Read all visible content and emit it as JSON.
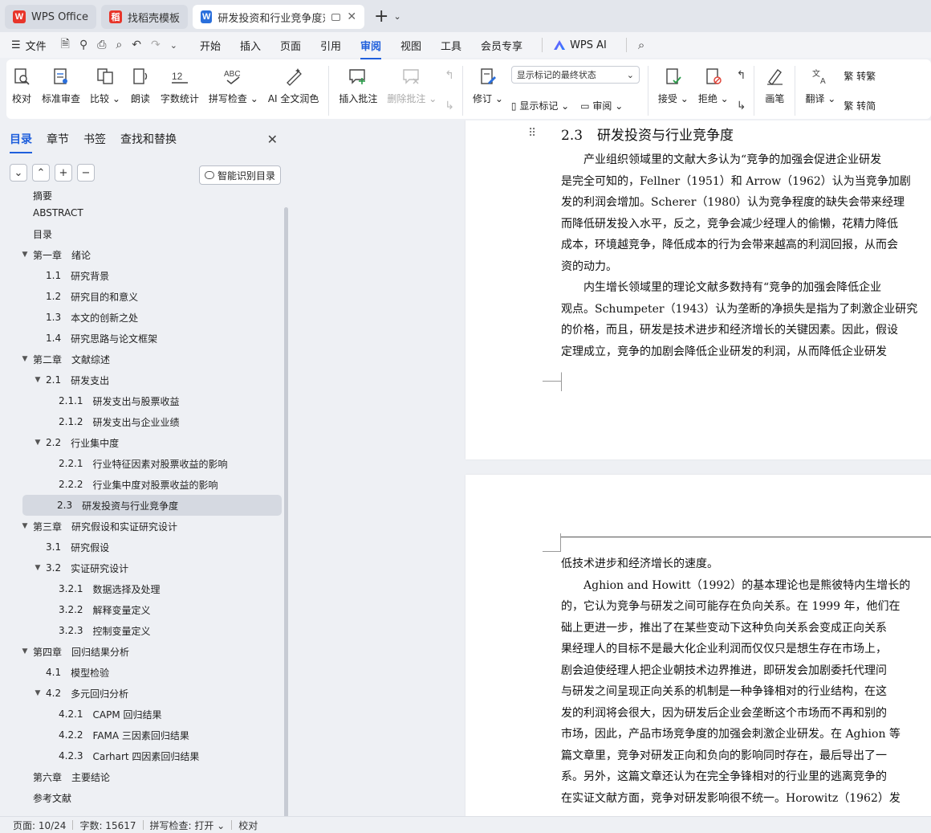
{
  "tabs": [
    {
      "label": "WPS Office",
      "logo": "W",
      "logo_color": "#e8352a",
      "icon": "wps-logo-icon"
    },
    {
      "label": "找稻壳模板",
      "logo": "稻",
      "logo_color": "#e8352a",
      "icon": "docer-logo-icon"
    },
    {
      "label": "研发投资和行业竞争度对股票",
      "logo": "W",
      "logo_color": "#2a6fdc",
      "icon": "writer-doc-icon",
      "active": true
    }
  ],
  "menubar": {
    "file": "文件",
    "items": [
      "开始",
      "插入",
      "页面",
      "引用",
      "审阅",
      "视图",
      "工具",
      "会员专享"
    ],
    "active": "审阅",
    "wps_ai": "WPS AI"
  },
  "ribbon": {
    "proofread": "校对",
    "std_review": "标准审查",
    "compare": "比较",
    "read_aloud": "朗读",
    "word_count": "字数统计",
    "spell_check": "拼写检查",
    "ai_polish": "AI 全文润色",
    "insert_comment": "插入批注",
    "delete_comment": "删除批注",
    "track_changes": "修订",
    "markup_dropdown": "显示标记的最终状态",
    "show_markup": "显示标记",
    "review": "审阅",
    "accept": "接受",
    "reject": "拒绝",
    "pen": "画笔",
    "translate": "翻译",
    "to_traditional": "转繁",
    "to_simplified": "转简"
  },
  "nav": {
    "tabs": [
      "目录",
      "章节",
      "书签",
      "查找和替换"
    ],
    "active_tab": "目录",
    "smart_btn": "智能识别目录",
    "toc": [
      {
        "num": "",
        "title": "摘要",
        "level": 0,
        "arrow": ""
      },
      {
        "num": "",
        "title": "ABSTRACT",
        "level": 0,
        "arrow": ""
      },
      {
        "num": "",
        "title": "目录",
        "level": 0,
        "arrow": ""
      },
      {
        "num": "第一章",
        "title": "绪论",
        "level": 0,
        "arrow": "▼"
      },
      {
        "num": "1.1",
        "title": "研究背景",
        "level": 1,
        "arrow": ""
      },
      {
        "num": "1.2",
        "title": "研究目的和意义",
        "level": 1,
        "arrow": ""
      },
      {
        "num": "1.3",
        "title": "本文的创新之处",
        "level": 1,
        "arrow": ""
      },
      {
        "num": "1.4",
        "title": "研究思路与论文框架",
        "level": 1,
        "arrow": ""
      },
      {
        "num": "第二章",
        "title": "文献综述",
        "level": 0,
        "arrow": "▼"
      },
      {
        "num": "2.1",
        "title": "研发支出",
        "level": 1,
        "arrow": "▼"
      },
      {
        "num": "2.1.1",
        "title": "研发支出与股票收益",
        "level": 2,
        "arrow": ""
      },
      {
        "num": "2.1.2",
        "title": "研发支出与企业业绩",
        "level": 2,
        "arrow": ""
      },
      {
        "num": "2.2",
        "title": "行业集中度",
        "level": 1,
        "arrow": "▼"
      },
      {
        "num": "2.2.1",
        "title": "行业特征因素对股票收益的影响",
        "level": 2,
        "arrow": ""
      },
      {
        "num": "2.2.2",
        "title": "行业集中度对股票收益的影响",
        "level": 2,
        "arrow": ""
      },
      {
        "num": "2.3",
        "title": "研发投资与行业竞争度",
        "level": 1,
        "arrow": "",
        "selected": true
      },
      {
        "num": "第三章",
        "title": "研究假设和实证研究设计",
        "level": 0,
        "arrow": "▼"
      },
      {
        "num": "3.1",
        "title": "研究假设",
        "level": 1,
        "arrow": ""
      },
      {
        "num": "3.2",
        "title": "实证研究设计",
        "level": 1,
        "arrow": "▼"
      },
      {
        "num": "3.2.1",
        "title": "数据选择及处理",
        "level": 2,
        "arrow": ""
      },
      {
        "num": "3.2.2",
        "title": "解释变量定义",
        "level": 2,
        "arrow": ""
      },
      {
        "num": "3.2.3",
        "title": "控制变量定义",
        "level": 2,
        "arrow": ""
      },
      {
        "num": "第四章",
        "title": "回归结果分析",
        "level": 0,
        "arrow": "▼"
      },
      {
        "num": "4.1",
        "title": "模型检验",
        "level": 1,
        "arrow": ""
      },
      {
        "num": "4.2",
        "title": "多元回归分析",
        "level": 1,
        "arrow": "▼"
      },
      {
        "num": "4.2.1",
        "title": "CAPM 回归结果",
        "level": 2,
        "arrow": ""
      },
      {
        "num": "4.2.2",
        "title": "FAMA 三因素回归结果",
        "level": 2,
        "arrow": ""
      },
      {
        "num": "4.2.3",
        "title": "Carhart 四因素回归结果",
        "level": 2,
        "arrow": ""
      },
      {
        "num": "第六章",
        "title": "主要结论",
        "level": 0,
        "arrow": ""
      },
      {
        "num": "",
        "title": "参考文献",
        "level": 0,
        "arrow": ""
      }
    ]
  },
  "document": {
    "heading_num": "2.3",
    "heading_title": "研发投资与行业竞争度",
    "page1_lines": [
      "　　产业组织领域里的文献大多认为“竞争的加强会促进企业研发",
      "是完全可知的，Fellner（1951）和 Arrow（1962）认为当竞争加剧",
      "发的利润会增加。Scherer（1980）认为竞争程度的缺失会带来经理",
      "而降低研发投入水平，反之，竞争会减少经理人的偷懒，花精力降低",
      "成本，环境越竞争，降低成本的行为会带来越高的利润回报，从而会",
      "资的动力。",
      "　　内生增长领域里的理论文献多数持有“竞争的加强会降低企业",
      "观点。Schumpeter（1943）认为垄断的净损失是指为了刺激企业研究",
      "的价格，而且，研发是技术进步和经济增长的关键因素。因此，假设",
      "定理成立，竞争的加剧会降低企业研发的利润，从而降低企业研发"
    ],
    "page2_lines": [
      "低技术进步和经济增长的速度。",
      "　　Aghion and Howitt（1992）的基本理论也是熊彼特内生增长的",
      "的，它认为竞争与研发之间可能存在负向关系。在 1999 年，他们在",
      "础上更进一步，推出了在某些变动下这种负向关系会变成正向关系",
      "果经理人的目标不是最大化企业利润而仅仅只是想生存在市场上，",
      "剧会迫使经理人把企业朝技术边界推进，即研发会加剧委托代理问",
      "与研发之间呈现正向关系的机制是一种争锋相对的行业结构，在这",
      "发的利润将会很大，因为研发后企业会垄断这个市场而不再和别的",
      "市场，因此，产品市场竞争度的加强会刺激企业研发。在 Aghion 等",
      "篇文章里，竞争对研发正向和负向的影响同时存在，最后导出了一",
      "系。另外，这篇文章还认为在完全争锋相对的行业里的逃离竞争的",
      "在实证文献方面，竞争对研发影响很不统一。Horowitz（1962）发"
    ]
  },
  "status": {
    "page": "页面: 10/24",
    "words": "字数: 15617",
    "spell": "拼写检查: 打开",
    "proof": "校对"
  }
}
